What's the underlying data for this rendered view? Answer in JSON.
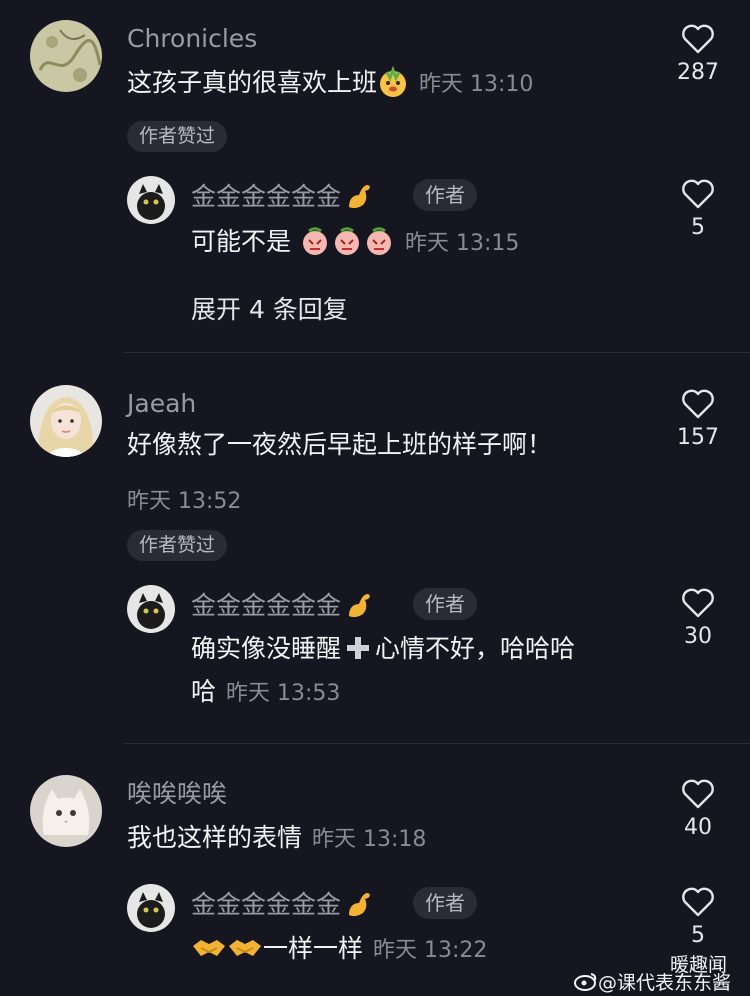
{
  "colors": {
    "background": "#161620",
    "secondary_text": "#9a9aa6",
    "chip_bg": "#2b2b35",
    "divider": "#2c2c35"
  },
  "comments": [
    {
      "author": "Chronicles",
      "text": "这孩子真的很喜欢上班",
      "time": "昨天 13:10",
      "likes": "287",
      "badge": "作者赞过",
      "reply": {
        "author": "金金金金金金",
        "author_tag": "作者",
        "text": "可能不是",
        "time": "昨天 13:15",
        "likes": "5"
      },
      "expand_label": "展开 4 条回复"
    },
    {
      "author": "Jaeah",
      "text": "好像熬了一夜然后早起上班的样子啊！",
      "time": "昨天 13:52",
      "likes": "157",
      "badge": "作者赞过",
      "reply": {
        "author": "金金金金金金",
        "author_tag": "作者",
        "text_part1": "确实像没睡醒",
        "text_part2": "心情不好，哈哈哈",
        "text_part3": "哈",
        "time": "昨天 13:53",
        "likes": "30"
      }
    },
    {
      "author": "唉唉唉唉",
      "text": "我也这样的表情",
      "time": "昨天 13:18",
      "likes": "40",
      "reply": {
        "author": "金金金金金金",
        "author_tag": "作者",
        "text": "一样一样",
        "time": "昨天 13:22",
        "likes": "5"
      }
    }
  ],
  "watermark": {
    "line1": "暖趣闻",
    "line2": "@课代表东东酱"
  },
  "icons": {
    "like": "heart-outline-icon",
    "flex": "flexed-biceps-icon",
    "peach": "peach-face-icon",
    "plus": "plus-icon",
    "handshake": "handshake-icon",
    "weibo": "weibo-logo-icon"
  }
}
